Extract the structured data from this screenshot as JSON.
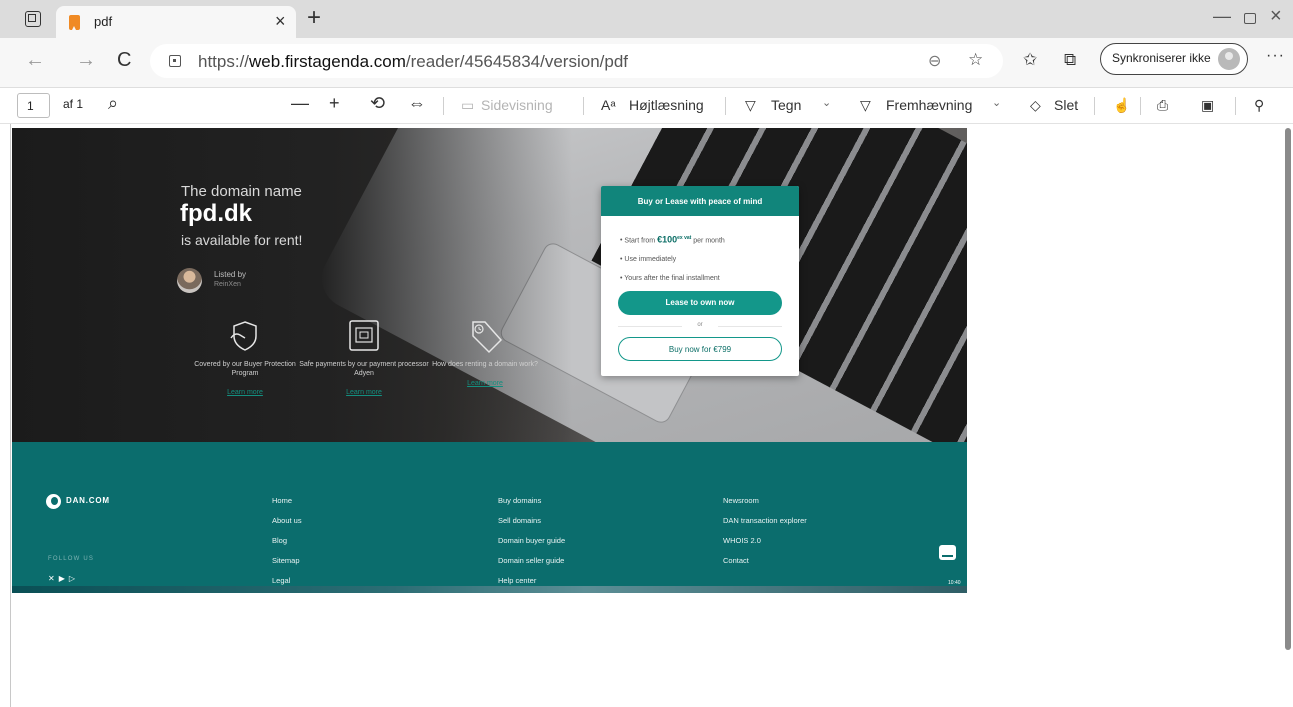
{
  "browser": {
    "tab": {
      "title": "pdf",
      "close": "×"
    },
    "new_tab": "+",
    "window": {
      "minimize": "—",
      "close": "×"
    },
    "nav": {
      "back": "←",
      "forward": "→",
      "refresh": "C"
    },
    "url": {
      "protocol": "https://",
      "host": "web.firstagenda.com",
      "path": "/reader/45645834/version/pdf"
    },
    "sync_label": "Synkroniserer ikke",
    "more": "···"
  },
  "pdf_toolbar": {
    "page_current": "1",
    "page_total": "af 1",
    "zoom_out": "—",
    "zoom_in": "+",
    "page_view": "Sidevisning",
    "read_aloud": "Højtlæsning",
    "draw": "Tegn",
    "highlight": "Fremhævning",
    "erase": "Slet"
  },
  "listing": {
    "line1": "The domain name",
    "domain": "fpd.dk",
    "line3": "is available for rent!",
    "listed_by": "Listed by",
    "seller": "ReinXen",
    "features": [
      {
        "icon": "shield-hand-icon",
        "text": "Covered by our Buyer Protection Program",
        "link": "Learn more"
      },
      {
        "icon": "payment-terminal-icon",
        "text": "Safe payments by our payment processor Adyen",
        "link": "Learn more"
      },
      {
        "icon": "price-tag-icon",
        "text": "How does renting a domain work?",
        "link": "Learn more"
      }
    ]
  },
  "offer": {
    "heading": "Buy or Lease with peace of mind",
    "start_from": "Start from",
    "price": "€100",
    "price_suffix": "ex vat",
    "per_month": "per month",
    "bullet2": "Use immediately",
    "bullet3": "Yours after the final installment",
    "lease_button": "Lease to own now",
    "or": "or",
    "buy_button": "Buy now for €799"
  },
  "footer": {
    "logo": "DAN.COM",
    "follow_us": "FOLLOW US",
    "col1": [
      "Home",
      "About us",
      "Blog",
      "Sitemap",
      "Legal"
    ],
    "col2": [
      "Buy domains",
      "Sell domains",
      "Domain buyer guide",
      "Domain seller guide",
      "Help center"
    ],
    "col3": [
      "Newsroom",
      "DAN transaction explorer",
      "WHOIS 2.0",
      "Contact"
    ],
    "tray_clock": "10:40"
  },
  "colors": {
    "brand_teal": "#0b6d6d",
    "button_teal": "#13978a"
  }
}
